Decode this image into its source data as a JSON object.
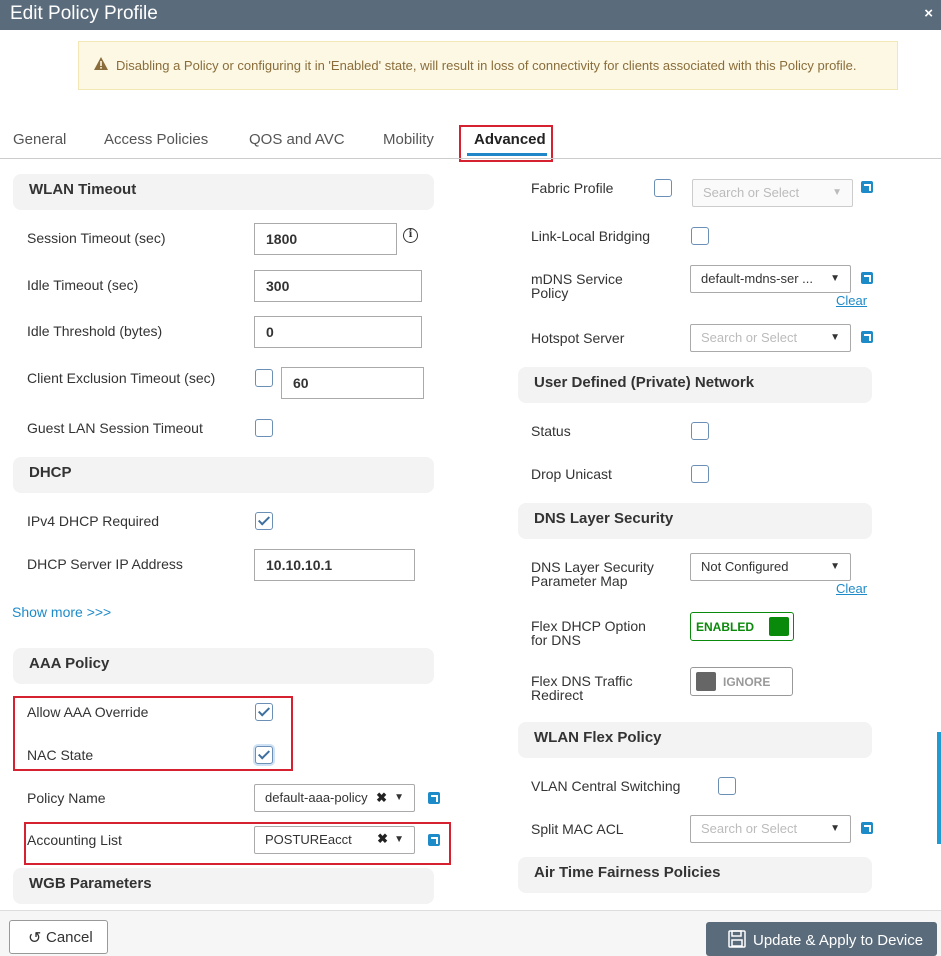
{
  "dialog": {
    "title": "Edit Policy Profile",
    "close": "×"
  },
  "alert": {
    "message": "Disabling a Policy or configuring it in 'Enabled' state, will result in loss of connectivity for clients associated with this Policy profile."
  },
  "tabs": [
    {
      "label": "General"
    },
    {
      "label": "Access Policies"
    },
    {
      "label": "QOS and AVC"
    },
    {
      "label": "Mobility"
    },
    {
      "label": "Advanced",
      "active": true
    }
  ],
  "wlan_timeout": {
    "heading": "WLAN Timeout",
    "session_timeout_label": "Session Timeout (sec)",
    "session_timeout_value": "1800",
    "idle_timeout_label": "Idle Timeout (sec)",
    "idle_timeout_value": "300",
    "idle_threshold_label": "Idle Threshold (bytes)",
    "idle_threshold_value": "0",
    "client_exclusion_label": "Client Exclusion Timeout (sec)",
    "client_exclusion_checked": false,
    "client_exclusion_value": "60",
    "guest_lan_label": "Guest LAN Session Timeout",
    "guest_lan_checked": false
  },
  "dhcp": {
    "heading": "DHCP",
    "ipv4_required_label": "IPv4 DHCP Required",
    "ipv4_required_checked": true,
    "server_ip_label": "DHCP Server IP Address",
    "server_ip_value": "10.10.10.1",
    "show_more": "Show more >>>"
  },
  "aaa_policy": {
    "heading": "AAA Policy",
    "allow_override_label": "Allow AAA Override",
    "allow_override_checked": true,
    "nac_state_label": "NAC State",
    "nac_state_checked": true,
    "policy_name_label": "Policy Name",
    "policy_name_value": "default-aaa-policy",
    "accounting_list_label": "Accounting List",
    "accounting_list_value": "POSTUREacct"
  },
  "wgb": {
    "heading": "WGB Parameters"
  },
  "right": {
    "fabric_profile_label": "Fabric Profile",
    "fabric_profile_placeholder": "Search or Select",
    "link_local_label": "Link-Local Bridging",
    "mdns_label_1": "mDNS Service",
    "mdns_label_2": "Policy",
    "mdns_value": "default-mdns-ser ...",
    "clear_label": "Clear",
    "hotspot_label": "Hotspot Server",
    "hotspot_placeholder": "Search or Select"
  },
  "udn": {
    "heading": "User Defined (Private) Network",
    "status_label": "Status",
    "drop_unicast_label": "Drop Unicast"
  },
  "dns_security": {
    "heading": "DNS Layer Security",
    "param_map_label_1": "DNS Layer Security",
    "param_map_label_2": "Parameter Map",
    "param_map_value": "Not Configured",
    "clear_label": "Clear",
    "flex_dhcp_label_1": "Flex DHCP Option",
    "flex_dhcp_label_2": "for DNS",
    "flex_dhcp_state": "ENABLED",
    "flex_dns_label_1": "Flex DNS Traffic",
    "flex_dns_label_2": "Redirect",
    "flex_dns_state": "IGNORE"
  },
  "wlan_flex": {
    "heading": "WLAN Flex Policy",
    "vlan_central_label": "VLAN Central Switching",
    "split_mac_label": "Split MAC ACL",
    "split_mac_placeholder": "Search or Select"
  },
  "airtime": {
    "heading": "Air Time Fairness Policies"
  },
  "footer": {
    "cancel_label": "Cancel",
    "apply_label": "Update & Apply to Device"
  },
  "colors": {
    "accent": "#1e8bc9",
    "highlight": "#d62230",
    "toggle_green": "#0a8a0a",
    "titlebar": "#5a6b7b"
  }
}
